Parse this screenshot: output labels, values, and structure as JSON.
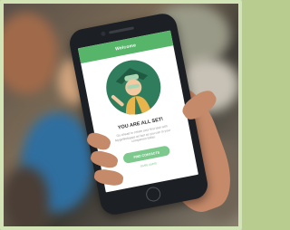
{
  "app": {
    "header_title": "Welcome",
    "heading": "YOU ARE ALL SET!",
    "description": "Go ahead to create your first task with MyppWebapps as fast as you can to your companion today.",
    "primary_button": "FIND CONTACTS",
    "secondary_link": "Invite users"
  },
  "colors": {
    "accent": "#57b56a",
    "button": "#7dc98d",
    "hero_background": "#2f7d5c",
    "frame": "#d2e3b6"
  }
}
